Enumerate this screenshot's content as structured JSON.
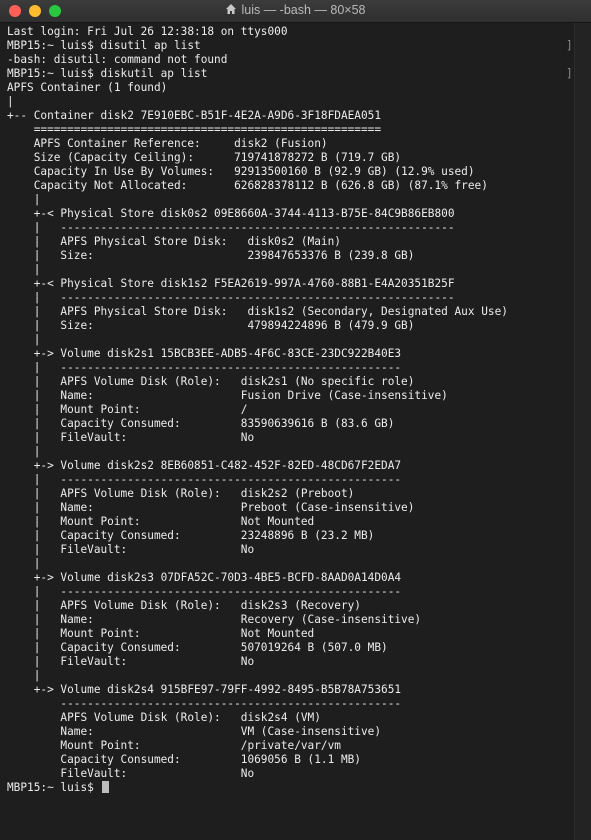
{
  "window": {
    "title": "luis — -bash — 80×58"
  },
  "terminal": {
    "lines": [
      "Last login: Fri Jul 26 12:38:18 on ttys000",
      "MBP15:~ luis$ disutil ap list",
      "-bash: disutil: command not found",
      "MBP15:~ luis$ diskutil ap list",
      "APFS Container (1 found)",
      "|",
      "+-- Container disk2 7E910EBC-B51F-4E2A-A9D6-3F18FDAEA051",
      "    ====================================================",
      "    APFS Container Reference:     disk2 (Fusion)",
      "    Size (Capacity Ceiling):      719741878272 B (719.7 GB)",
      "    Capacity In Use By Volumes:   92913500160 B (92.9 GB) (12.9% used)",
      "    Capacity Not Allocated:       626828378112 B (626.8 GB) (87.1% free)",
      "    |",
      "    +-< Physical Store disk0s2 09E8660A-3744-4113-B75E-84C9B86EB800",
      "    |   -----------------------------------------------------------",
      "    |   APFS Physical Store Disk:   disk0s2 (Main)",
      "    |   Size:                       239847653376 B (239.8 GB)",
      "    |",
      "    +-< Physical Store disk1s2 F5EA2619-997A-4760-88B1-E4A20351B25F",
      "    |   -----------------------------------------------------------",
      "    |   APFS Physical Store Disk:   disk1s2 (Secondary, Designated Aux Use)",
      "    |   Size:                       479894224896 B (479.9 GB)",
      "    |",
      "    +-> Volume disk2s1 15BCB3EE-ADB5-4F6C-83CE-23DC922B40E3",
      "    |   ---------------------------------------------------",
      "    |   APFS Volume Disk (Role):   disk2s1 (No specific role)",
      "    |   Name:                      Fusion Drive (Case-insensitive)",
      "    |   Mount Point:               /",
      "    |   Capacity Consumed:         83590639616 B (83.6 GB)",
      "    |   FileVault:                 No",
      "    |",
      "    +-> Volume disk2s2 8EB60851-C482-452F-82ED-48CD67F2EDA7",
      "    |   ---------------------------------------------------",
      "    |   APFS Volume Disk (Role):   disk2s2 (Preboot)",
      "    |   Name:                      Preboot (Case-insensitive)",
      "    |   Mount Point:               Not Mounted",
      "    |   Capacity Consumed:         23248896 B (23.2 MB)",
      "    |   FileVault:                 No",
      "    |",
      "    +-> Volume disk2s3 07DFA52C-70D3-4BE5-BCFD-8AAD0A14D0A4",
      "    |   ---------------------------------------------------",
      "    |   APFS Volume Disk (Role):   disk2s3 (Recovery)",
      "    |   Name:                      Recovery (Case-insensitive)",
      "    |   Mount Point:               Not Mounted",
      "    |   Capacity Consumed:         507019264 B (507.0 MB)",
      "    |   FileVault:                 No",
      "    |",
      "    +-> Volume disk2s4 915BFE97-79FF-4992-8495-B5B78A753651",
      "        ---------------------------------------------------",
      "        APFS Volume Disk (Role):   disk2s4 (VM)",
      "        Name:                      VM (Case-insensitive)",
      "        Mount Point:               /private/var/vm",
      "        Capacity Consumed:         1069056 B (1.1 MB)",
      "        FileVault:                 No"
    ],
    "prompt": "MBP15:~ luis$ "
  },
  "colors": {
    "background": "#1e1e1e",
    "text": "#ececec",
    "close": "#fe5f57",
    "minimize": "#febc2e",
    "maximize": "#28c840"
  }
}
